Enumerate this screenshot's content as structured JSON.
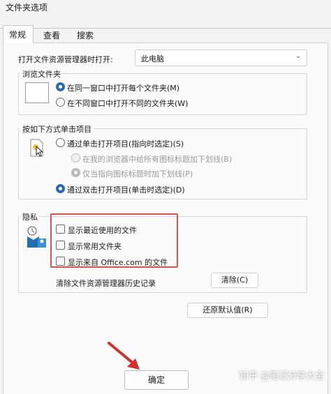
{
  "window": {
    "title": "文件夹选项"
  },
  "tabs": [
    {
      "label": "常规",
      "active": true
    },
    {
      "label": "查看",
      "active": false
    },
    {
      "label": "搜索",
      "active": false
    }
  ],
  "general": {
    "open_explorer_label": "打开文件资源管理器时打开:",
    "open_explorer_value": "此电脑",
    "browse_folders": {
      "title": "浏览文件夹",
      "options": [
        {
          "label": "在同一窗口中打开每个文件夹(M)",
          "checked": true
        },
        {
          "label": "在不同窗口中打开不同的文件夹(W)",
          "checked": false
        }
      ]
    },
    "click_items": {
      "title": "按如下方式单击项目",
      "single_click": "通过单击打开项目(指向时选定)(S)",
      "sub_options": [
        {
          "label": "在我的浏览器中给所有图标标题加下划线(B)",
          "checked": false
        },
        {
          "label": "仅当指向图标标题时加下划线(P)",
          "checked": true
        }
      ],
      "double_click": "通过双击打开项目(单击时选定)(D)"
    },
    "privacy": {
      "title": "隐私",
      "checkboxes": [
        {
          "label": "显示最近使用的文件",
          "checked": false
        },
        {
          "label": "显示常用文件夹",
          "checked": false
        },
        {
          "label": "显示来自 Office.com 的文件",
          "checked": false
        }
      ],
      "clear_history_label": "清除文件资源管理器历史记录",
      "clear_button": "清除(C)"
    },
    "restore_defaults": "还原默认值(R)"
  },
  "footer": {
    "ok": "确定"
  },
  "watermark": "知乎 @笔记分享大全",
  "colors": {
    "accent": "#2b6cb0",
    "highlight": "#d9534f"
  }
}
